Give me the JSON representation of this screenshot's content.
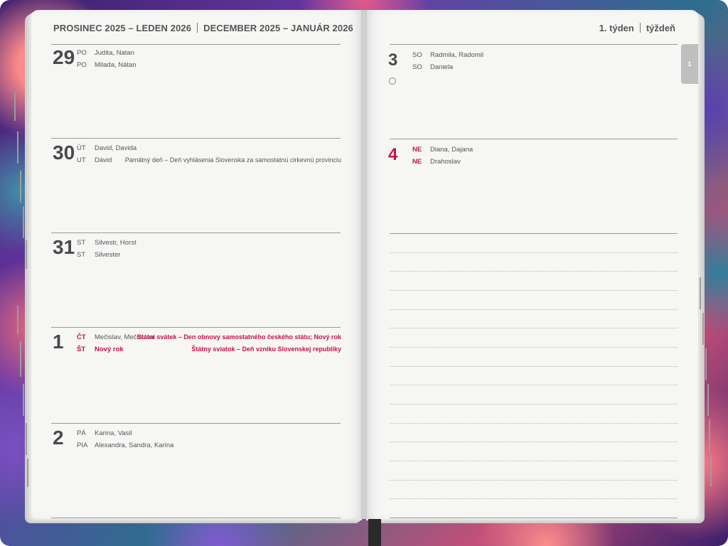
{
  "header": {
    "left_cz": "PROSINEC 2025 – LEDEN 2026",
    "left_sk": "DECEMBER 2025 – JANUÁR 2026",
    "week_cz": "1. týden",
    "week_sk": "týždeň"
  },
  "side_tab": "1",
  "days": [
    {
      "number": "29",
      "line1": {
        "day": "PO",
        "names": "Judita, Natan",
        "holiday": ""
      },
      "line2": {
        "day": "PO",
        "names": "Milada, Nátan",
        "holiday": ""
      },
      "highlight": false
    },
    {
      "number": "30",
      "line1": {
        "day": "ÚT",
        "names": "David, Davida",
        "holiday": ""
      },
      "line2": {
        "day": "UT",
        "names": "Dávid",
        "holiday": "Pamätný deň – Deň vyhlásenia Slovenska za samostatnú cirkevnú provinciu"
      },
      "highlight": false
    },
    {
      "number": "31",
      "line1": {
        "day": "ST",
        "names": "Silvestr, Horst",
        "holiday": ""
      },
      "line2": {
        "day": "ST",
        "names": "Silvester",
        "holiday": ""
      },
      "highlight": false
    },
    {
      "number": "1",
      "line1": {
        "day": "ČT",
        "names": "Mečislav, Mečislava",
        "holiday": "Státní svátek – Den obnovy samostatného českého státu; Nový rok"
      },
      "line2": {
        "day": "ŠT",
        "names": "Nový rok",
        "holiday": "Štátny sviatok – Deň vzniku Slovenskej republiky"
      },
      "highlight": true
    },
    {
      "number": "2",
      "line1": {
        "day": "PÁ",
        "names": "Karina, Vasil",
        "holiday": ""
      },
      "line2": {
        "day": "PIA",
        "names": "Alexandra, Sandra, Karina",
        "holiday": ""
      },
      "highlight": false
    },
    {
      "number": "3",
      "line1": {
        "day": "SO",
        "names": "Radmila, Radomil",
        "holiday": ""
      },
      "line2": {
        "day": "SO",
        "names": "Daniela",
        "holiday": ""
      },
      "highlight": false
    },
    {
      "number": "4",
      "line1": {
        "day": "NE",
        "names": "Diana, Dajana",
        "holiday": ""
      },
      "line2": {
        "day": "NE",
        "names": "Drahoslav",
        "holiday": ""
      },
      "highlight": true
    }
  ]
}
